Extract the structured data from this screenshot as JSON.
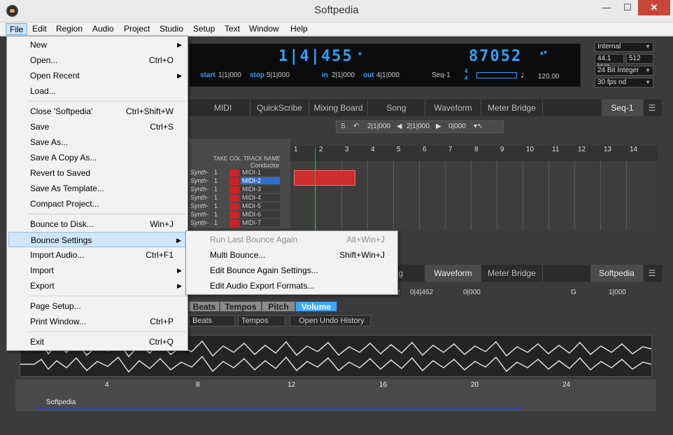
{
  "window": {
    "title": "Softpedia",
    "minimize": "—",
    "maximize": "☐",
    "close": "✕"
  },
  "menubar": [
    "File",
    "Edit",
    "Region",
    "Audio",
    "Project",
    "Studio",
    "Setup",
    "Text",
    "Window",
    "Help"
  ],
  "file_menu": {
    "items": [
      {
        "label": "New",
        "shortcut": "",
        "submenu": true
      },
      {
        "label": "Open...",
        "shortcut": "Ctrl+O",
        "submenu": false
      },
      {
        "label": "Open Recent",
        "shortcut": "",
        "submenu": true
      },
      {
        "label": "Load...",
        "shortcut": "",
        "submenu": false
      },
      {
        "label": "Close 'Softpedia'",
        "shortcut": "Ctrl+Shift+W",
        "submenu": false
      },
      {
        "label": "Save",
        "shortcut": "Ctrl+S",
        "submenu": false
      },
      {
        "label": "Save As...",
        "shortcut": "",
        "submenu": false
      },
      {
        "label": "Save A Copy As...",
        "shortcut": "",
        "submenu": false
      },
      {
        "label": "Revert to Saved",
        "shortcut": "",
        "submenu": false
      },
      {
        "label": "Save As Template...",
        "shortcut": "",
        "submenu": false
      },
      {
        "label": "Compact Project...",
        "shortcut": "",
        "submenu": false
      },
      {
        "label": "Bounce to Disk...",
        "shortcut": "Win+J",
        "submenu": false
      },
      {
        "label": "Bounce Settings",
        "shortcut": "",
        "submenu": true
      },
      {
        "label": "Import Audio...",
        "shortcut": "Ctrl+F1",
        "submenu": false
      },
      {
        "label": "Import",
        "shortcut": "",
        "submenu": true
      },
      {
        "label": "Export",
        "shortcut": "",
        "submenu": true
      },
      {
        "label": "Page Setup...",
        "shortcut": "",
        "submenu": false
      },
      {
        "label": "Print Window...",
        "shortcut": "Ctrl+P",
        "submenu": false
      },
      {
        "label": "Exit",
        "shortcut": "Ctrl+Q",
        "submenu": false
      }
    ],
    "submenu_arrow": "▶"
  },
  "bounce_submenu": {
    "items": [
      {
        "label": "Run Last Bounce Again",
        "shortcut": "Alt+Win+J",
        "disabled": true
      },
      {
        "label": "Multi Bounce...",
        "shortcut": "Shift+Win+J",
        "disabled": false
      },
      {
        "label": "Edit Bounce Again Settings...",
        "shortcut": "",
        "disabled": false
      },
      {
        "label": "Edit Audio Export Formats...",
        "shortcut": "",
        "disabled": false
      }
    ]
  },
  "counter": {
    "position": "1|4|455",
    "samples": "87052",
    "start_label": "start",
    "start_value": "1|1|000",
    "stop_label": "stop",
    "stop_value": "5|1|000",
    "in_label": "in",
    "in_value": "2|1|000",
    "out_label": "out",
    "out_value": "4|1|000",
    "sequence": "Seq-1",
    "meter_top": "4",
    "meter_bottom": "4",
    "tempo": "120.00"
  },
  "settings": {
    "sync": "Internal",
    "sample_rate": "44.1 kHz",
    "buffer": "512",
    "bit_depth": "24 Bit Integer",
    "frame_rate": "30 fps nd"
  },
  "top_tabs": [
    "MIDI",
    "QuickScribe",
    "Mixing Board",
    "Song",
    "Waveform",
    "Meter Bridge"
  ],
  "top_tab_right": "Seq-1",
  "toolbar1": {
    "solo": "S",
    "pos1": "2|1|000",
    "pos2": "2|1|000",
    "pos3": "0|000"
  },
  "track_headers": {
    "take": "TAKE",
    "col": "COL",
    "name": "TRACK NAME",
    "conductor": "Conductor"
  },
  "tracks": [
    {
      "synth": "Synth-",
      "take": "1",
      "name": "MIDI-1"
    },
    {
      "synth": "Synth-",
      "take": "1",
      "name": "MIDI-2"
    },
    {
      "synth": "Synth-",
      "take": "1",
      "name": "MIDI-3"
    },
    {
      "synth": "Synth-",
      "take": "1",
      "name": "MIDI-4"
    },
    {
      "synth": "Synth-",
      "take": "1",
      "name": "MIDI-5"
    },
    {
      "synth": "Synth-",
      "take": "1",
      "name": "MIDI-6"
    },
    {
      "synth": "Synth-",
      "take": "1",
      "name": "MIDI-7"
    }
  ],
  "ruler_bars": [
    "1",
    "2",
    "3",
    "4",
    "5",
    "6",
    "7",
    "8",
    "9",
    "10",
    "11",
    "12",
    "13",
    "14"
  ],
  "lower_tabs": [
    "ng",
    "Waveform",
    "Meter Bridge"
  ],
  "lower_tab_right": "Softpedia",
  "lower_toolbar": {
    "pos1": "2",
    "pos2": "0|4|462",
    "pos3": "0|000",
    "g": "G",
    "pos4": "1|000"
  },
  "sub_tabs": [
    "Beats",
    "Tempos",
    "Pitch",
    "Volume"
  ],
  "dropdowns": {
    "beats": "Beats",
    "tempos": "Tempos",
    "undo": "Open Undo History"
  },
  "timeline_bars": [
    "4",
    "8",
    "12",
    "16",
    "20",
    "24"
  ],
  "clip_name": "Softpedia",
  "colors": {
    "accent_blue": "#2ea3ff",
    "track_red": "#cc2222",
    "menu_highlight": "#cfe5f9"
  }
}
